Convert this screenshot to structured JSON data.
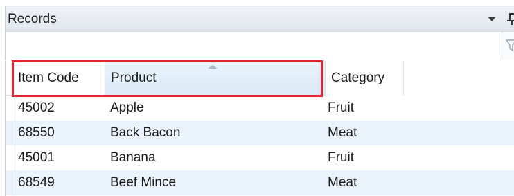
{
  "panel": {
    "title": "Records",
    "filter": {
      "value": "",
      "placeholder": ""
    }
  },
  "grid": {
    "columns": [
      {
        "label": "Item Code"
      },
      {
        "label": "Product"
      },
      {
        "label": "Category"
      }
    ],
    "sorted_column": "Product",
    "sort_direction": "ascending",
    "rows": [
      {
        "code": "45002",
        "product": "Apple",
        "category": "Fruit"
      },
      {
        "code": "68550",
        "product": "Back Bacon",
        "category": "Meat"
      },
      {
        "code": "45001",
        "product": "Banana",
        "category": "Fruit"
      },
      {
        "code": "68549",
        "product": "Beef Mince",
        "category": "Meat"
      }
    ]
  },
  "icons": {
    "pane_menu": "chevron-down-icon",
    "pin": "pin-icon",
    "filter": "filter-icon"
  },
  "colors": {
    "highlight": "#e4242f",
    "alt_row": "#eaf3fb",
    "sorted_header": "#dbeaf7"
  }
}
